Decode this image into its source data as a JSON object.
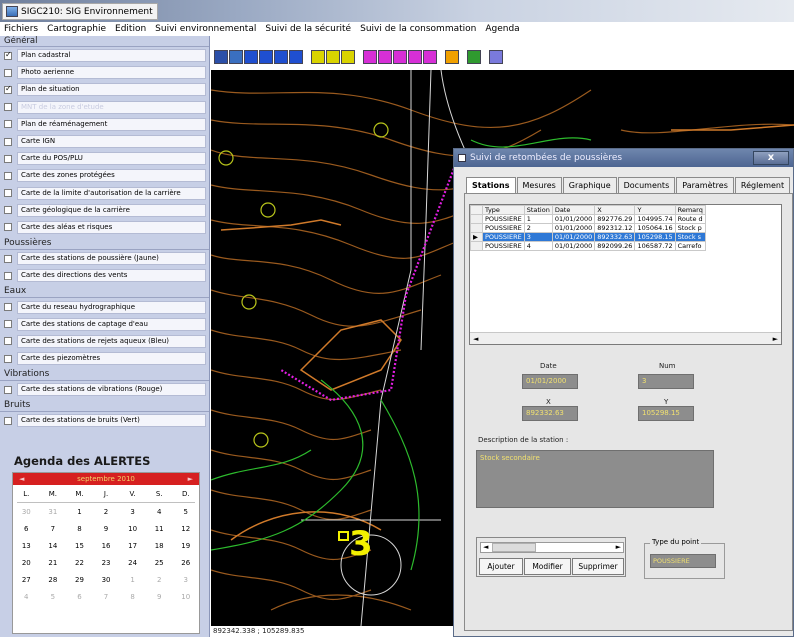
{
  "window": {
    "title": "SIGC210: SIG Environnement"
  },
  "menu": [
    "Fichiers",
    "Cartographie",
    "Edition",
    "Suivi environnemental",
    "Suivi de la sécurité",
    "Suivi de la consommation",
    "Agenda"
  ],
  "left_panel": {
    "general_header": "Général",
    "general_items": [
      {
        "label": "Plan cadastral",
        "checked": true,
        "disabled": false
      },
      {
        "label": "Photo aerienne",
        "checked": false,
        "disabled": false
      },
      {
        "label": "Plan de situation",
        "checked": true,
        "disabled": false
      },
      {
        "label": "MNT de la zone d'etude",
        "checked": false,
        "disabled": true
      },
      {
        "label": "Plan de réaménagement",
        "checked": false,
        "disabled": false
      },
      {
        "label": "Carte IGN",
        "checked": false,
        "disabled": false
      },
      {
        "label": "Carte du POS/PLU",
        "checked": false,
        "disabled": false
      },
      {
        "label": "Carte des zones protégées",
        "checked": false,
        "disabled": false
      },
      {
        "label": "Carte de la limite d'autorisation de la carrière",
        "checked": false,
        "disabled": false
      },
      {
        "label": "Carte géologique de la carrière",
        "checked": false,
        "disabled": false
      },
      {
        "label": "Carte des aléas et risques",
        "checked": false,
        "disabled": false
      }
    ],
    "poussieres_header": "Poussières",
    "poussieres_items": [
      {
        "label": "Carte des stations de poussière (Jaune)",
        "checked": false
      },
      {
        "label": "Carte des directions des vents",
        "checked": false
      }
    ],
    "eaux_header": "Eaux",
    "eaux_items": [
      {
        "label": "Carte du reseau hydrographique",
        "checked": false
      },
      {
        "label": "Carte des stations de captage d'eau",
        "checked": false
      },
      {
        "label": "Carte des stations de rejets aqueux (Bleu)",
        "checked": false
      },
      {
        "label": "Carte des piezomètres",
        "checked": false
      }
    ],
    "vibrations_header": "Vibrations",
    "vibrations_items": [
      {
        "label": "Carte des stations de vibrations (Rouge)",
        "checked": false
      }
    ],
    "bruits_header": "Bruits",
    "bruits_items": [
      {
        "label": "Carte des stations de bruits (Vert)",
        "checked": false
      }
    ],
    "agenda_title": "Agenda des ALERTES",
    "calendar": {
      "month": "septembre 2010",
      "prev": "◄",
      "next": "►",
      "days": [
        "L.",
        "M.",
        "M.",
        "J.",
        "V.",
        "S.",
        "D."
      ],
      "weeks": [
        [
          "30",
          "31",
          "1",
          "2",
          "3",
          "4",
          "5"
        ],
        [
          "6",
          "7",
          "8",
          "9",
          "10",
          "11",
          "12"
        ],
        [
          "13",
          "14",
          "15",
          "16",
          "17",
          "18",
          "19"
        ],
        [
          "20",
          "21",
          "22",
          "23",
          "24",
          "25",
          "26"
        ],
        [
          "27",
          "28",
          "29",
          "30",
          "1",
          "2",
          "3"
        ],
        [
          "4",
          "5",
          "6",
          "7",
          "8",
          "9",
          "10"
        ]
      ],
      "grey_mask": [
        [
          1,
          1,
          0,
          0,
          0,
          0,
          0
        ],
        [
          0,
          0,
          0,
          0,
          0,
          0,
          0
        ],
        [
          0,
          0,
          0,
          0,
          0,
          0,
          0
        ],
        [
          0,
          0,
          0,
          0,
          0,
          0,
          0
        ],
        [
          0,
          0,
          0,
          0,
          1,
          1,
          1
        ],
        [
          1,
          1,
          1,
          1,
          1,
          1,
          1
        ]
      ]
    }
  },
  "toolbar": {
    "buttons": [
      {
        "icon": "save-icon",
        "color": "#2b4fa8"
      },
      {
        "icon": "print-icon",
        "color": "#3a6fc0"
      },
      {
        "icon": "layer-icon",
        "color": "#1f4fd0"
      },
      {
        "icon": "zoom-in-icon",
        "color": "#1f4fd0"
      },
      {
        "icon": "zoom-out-icon",
        "color": "#1f4fd0"
      },
      {
        "icon": "pan-icon",
        "color": "#1f4fd0"
      },
      {
        "icon": "identify-icon",
        "color": "#d9d300"
      },
      {
        "icon": "select-icon",
        "color": "#d9d300"
      },
      {
        "icon": "measure-icon",
        "color": "#d9d300"
      },
      {
        "icon": "station-dust-icon",
        "color": "#d62fd6"
      },
      {
        "icon": "station-water-icon",
        "color": "#d62fd6"
      },
      {
        "icon": "station-vibration-icon",
        "color": "#d62fd6"
      },
      {
        "icon": "station-noise-icon",
        "color": "#d62fd6"
      },
      {
        "icon": "station-other-icon",
        "color": "#d62fd6"
      },
      {
        "icon": "alert-icon",
        "color": "#f0a000"
      },
      {
        "icon": "report-icon",
        "color": "#2f9a2f"
      },
      {
        "icon": "settings-icon",
        "color": "#7a7adc"
      }
    ]
  },
  "map": {
    "station_label": "3",
    "coordinates": "892342.338 ; 105289.835"
  },
  "dialog": {
    "title": "Suivi de retombées de poussières",
    "close_label": "x",
    "tabs": [
      "Stations",
      "Mesures",
      "Graphique",
      "Documents",
      "Paramètres",
      "Réglement"
    ],
    "active_tab": "Stations",
    "grid": {
      "columns": [
        "Type",
        "Station",
        "Date",
        "X",
        "Y",
        "Remarq"
      ],
      "rows": [
        [
          "POUSSIERE",
          "1",
          "01/01/2000",
          "892776.29",
          "104995.74",
          "Route d"
        ],
        [
          "POUSSIERE",
          "2",
          "01/01/2000",
          "892312.12",
          "105064.16",
          "Stock p"
        ],
        [
          "POUSSIERE",
          "3",
          "01/01/2000",
          "892332.63",
          "105298.15",
          "Stock s"
        ],
        [
          "POUSSIERE",
          "4",
          "01/01/2000",
          "892099.26",
          "106587.72",
          "Carrefo"
        ]
      ],
      "selected_row": 2
    },
    "fields": {
      "date_label": "Date",
      "date_value": "01/01/2000",
      "num_label": "Num",
      "num_value": "3",
      "x_label": "X",
      "x_value": "892332.63",
      "y_label": "Y",
      "y_value": "105298.15",
      "desc_label": "Description de la station :",
      "desc_value": "Stock secondaire",
      "type_label": "Type du point",
      "type_value": "POUSSIERE"
    },
    "buttons": {
      "add": "Ajouter",
      "modify": "Modifier",
      "delete": "Supprimer"
    }
  }
}
